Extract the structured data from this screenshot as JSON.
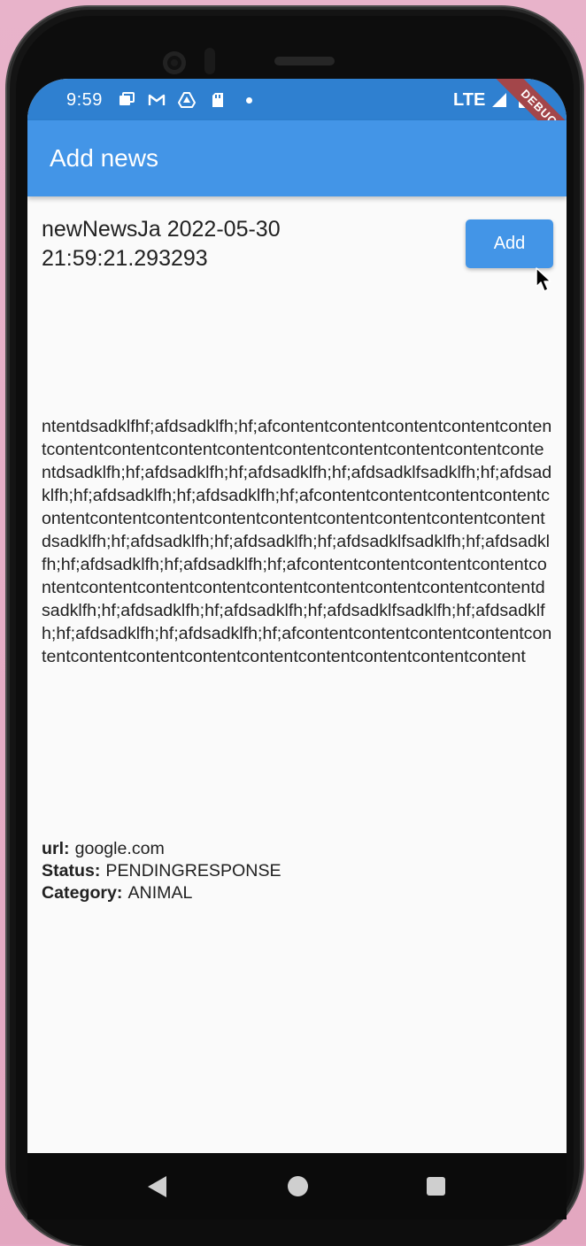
{
  "status_bar": {
    "time": "9:59",
    "network": "LTE",
    "icons": [
      "chat-notification-icon",
      "gmail-icon",
      "drive-icon",
      "sd-card-icon",
      "dot-icon",
      "signal-icon",
      "battery-icon"
    ],
    "debug_banner": "DEBUG"
  },
  "app_bar": {
    "title": "Add news"
  },
  "news": {
    "title": "newNewsJa 2022-05-30 21:59:21.293293",
    "add_label": "Add",
    "content": "ntentdsadklfhf;afdsadklfh;hf;afcontentcontentcontentcontentcontentcontentcontentcontentcontentcontentcontentcontentcontentcontentdsadklfh;hf;afdsadklfh;hf;afdsadklfh;hf;afdsadklfsadklfh;hf;afdsadklfh;hf;afdsadklfh;hf;afdsadklfh;hf;afcontentcontentcontentcontentcontentcontentcontentcontentcontentcontentcontentcontentcontentdsadklfh;hf;afdsadklfh;hf;afdsadklfh;hf;afdsadklfsadklfh;hf;afdsadklfh;hf;afdsadklfh;hf;afdsadklfh;hf;afcontentcontentcontentcontentcontentcontentcontentcontentcontentcontentcontentcontentcontentdsadklfh;hf;afdsadklfh;hf;afdsadklfh;hf;afdsadklfsadklfh;hf;afdsadklfh;hf;afdsadklfh;hf;afdsadklfh;hf;afcontentcontentcontentcontentcontentcontentcontentcontentcontentcontentcontentcontentcontent",
    "url_label": "url:",
    "url_value": "google.com",
    "status_label": "Status:",
    "status_value": "PENDINGRESPONSE",
    "category_label": "Category:",
    "category_value": "ANIMAL"
  },
  "nav_bar": {
    "icons": [
      "back-icon",
      "home-icon",
      "recents-icon"
    ]
  },
  "colors": {
    "app_bar": "#4395e7",
    "status_bar": "#2f80d0",
    "background": "#fafafa",
    "debug_banner": "#a3464a"
  }
}
